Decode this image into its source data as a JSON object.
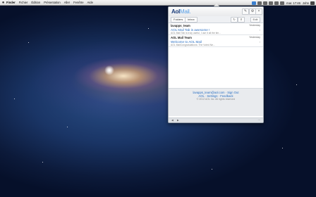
{
  "menubar": {
    "apple": "",
    "items": [
      "Finder",
      "Fichier",
      "Édition",
      "Présentation",
      "Aller",
      "Fenêtre",
      "Aide"
    ],
    "clock": "mar. 17:46",
    "user": "John"
  },
  "panel": {
    "logo_brand": "Aol",
    "logo_suffix": "Mail.",
    "tabs": {
      "folders": "Folders",
      "inbox": "Inbox"
    },
    "toolbar_edit": "Edit",
    "messages": [
      {
        "from": "lavapps_team",
        "date": "Yesterday",
        "subject": "AOL Mail Tab is awesome !",
        "preview": "AOL Mail Tab is truly useful, I use it all the tim..."
      },
      {
        "from": "AOL Mail Team",
        "date": "Yesterday",
        "subject": "Welcome to AOL Mail",
        "preview": "AOL MailCongratulations: The Voted Ne..."
      }
    ],
    "footer": {
      "line1": "lavapps_team@aol.com · Sign Out",
      "line2": "AOL · Settings · Feedback",
      "line3": "© 2012 AOL Inc. All rights reserved"
    }
  }
}
